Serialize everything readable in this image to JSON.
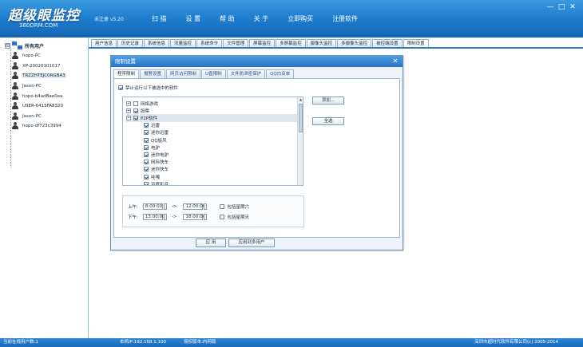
{
  "app": {
    "title": "超级眼监控",
    "subtitle": "360DRM.COM",
    "version": "未注册 v5.20"
  },
  "top_menu": [
    "扫 描",
    "设 置",
    "帮 助",
    "关 于",
    "立即购买",
    "注册软件"
  ],
  "window_controls": [
    "—",
    "□",
    "✕"
  ],
  "sidebar": {
    "toggle": "⊟",
    "root_label": "所有用户",
    "users": [
      {
        "name": "hopo-PC",
        "selected": false
      },
      {
        "name": "XP-20020101017",
        "selected": false
      },
      {
        "name": "TRZZHTEJC0RGBA3",
        "selected": true
      },
      {
        "name": "Jason-PC",
        "selected": false
      },
      {
        "name": "hopo-b4adBae0ea",
        "selected": false
      },
      {
        "name": "USER-6415FA8320",
        "selected": false
      },
      {
        "name": "Jason-PC",
        "selected": false
      },
      {
        "name": "hopo-df723c3994",
        "selected": false
      }
    ]
  },
  "main_tabs": [
    {
      "label": "用户信息",
      "active": false
    },
    {
      "label": "历史记录",
      "active": false
    },
    {
      "label": "系统信息",
      "active": false
    },
    {
      "label": "流量监控",
      "active": false
    },
    {
      "label": "系统命令",
      "active": false
    },
    {
      "label": "文件管理",
      "active": false
    },
    {
      "label": "屏幕监控",
      "active": false
    },
    {
      "label": "多屏幕监控",
      "active": false
    },
    {
      "label": "摄像头监控",
      "active": false
    },
    {
      "label": "多摄像头监控",
      "active": false
    },
    {
      "label": "被控端设置",
      "active": false
    },
    {
      "label": "限制设置",
      "active": true
    }
  ],
  "dialog": {
    "title": "限制设置",
    "close": "✕",
    "tabs": [
      {
        "label": "程序限制",
        "active": true
      },
      {
        "label": "报警设置",
        "active": false
      },
      {
        "label": "网页访问限制",
        "active": false
      },
      {
        "label": "U盘限制",
        "active": false
      },
      {
        "label": "文件防泄密保护",
        "active": false
      },
      {
        "label": "QQ白名单",
        "active": false
      }
    ],
    "forbid_label": "禁止运行以下被选中的软件",
    "forbid_checked": true,
    "programs": [
      {
        "label": "网络游戏",
        "level": 0,
        "expander": "+",
        "checked": false
      },
      {
        "label": "股票",
        "level": 0,
        "expander": "+",
        "checked": true
      },
      {
        "label": "P2P软件",
        "level": 0,
        "expander": "−",
        "checked": true,
        "highlight": true
      },
      {
        "label": "迅雷",
        "level": 1,
        "checked": true
      },
      {
        "label": "迷你迅雷",
        "level": 1,
        "checked": true
      },
      {
        "label": "QQ旋风",
        "level": 1,
        "checked": true
      },
      {
        "label": "电驴",
        "level": 1,
        "checked": true
      },
      {
        "label": "迷你电驴",
        "level": 1,
        "checked": true
      },
      {
        "label": "网际快车",
        "level": 1,
        "checked": true
      },
      {
        "label": "迷你快车",
        "level": 1,
        "checked": true
      },
      {
        "label": "哇嘎",
        "level": 1,
        "checked": true
      },
      {
        "label": "百度影音",
        "level": 1,
        "checked": true
      }
    ],
    "add_button": "添加...",
    "select_all_button": "全选",
    "time": {
      "am_label": "上午:",
      "am_start": "8:00:00",
      "am_end": "12:00:00",
      "pm_label": "下午:",
      "pm_start": "13:00:00",
      "pm_end": "18:00:00",
      "arrow": "->",
      "include_saturday": "包括星期六",
      "include_sunday": "包括星期天",
      "saturday_checked": false,
      "sunday_checked": false
    },
    "apply_button": "应 用",
    "apply_multi_button": "应用到多用户"
  },
  "status_bar": {
    "online": "当前在线用户数:1",
    "ip": "本机IP:192.168.1.100",
    "license": "授权版本:内网版",
    "copyright": "深圳市超时代软件有限公司(c) 2005-2014"
  },
  "colors": {
    "header_top": "#3a9be0",
    "header_bottom": "#1466b6",
    "accent": "#2f7ccc",
    "panel_bg": "#eef3f9",
    "status_bar": "#1868ba"
  }
}
